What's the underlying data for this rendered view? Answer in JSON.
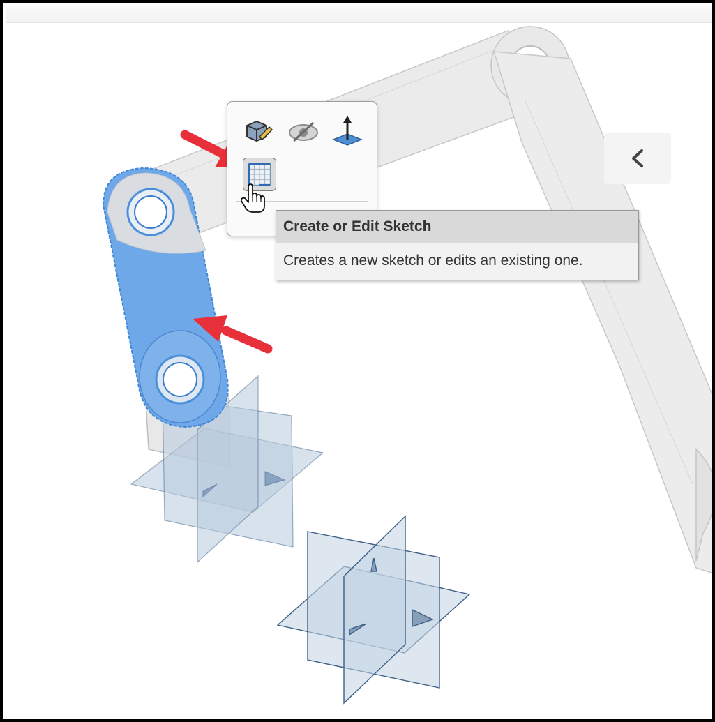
{
  "tooltip": {
    "title": "Create or Edit Sketch",
    "description": "Creates a new sketch or edits an existing one."
  },
  "toolbar": {
    "buttons": [
      {
        "icon": "edit-part-icon"
      },
      {
        "icon": "hide-icon"
      },
      {
        "icon": "normal-to-icon"
      },
      {
        "icon": "sketch-icon",
        "selected": true
      }
    ]
  },
  "colors": {
    "selected_face": "#6fa8e8",
    "selected_edge": "#3f86d8",
    "plane_fill": "#b8cadc",
    "plane_edge": "#4e6e92",
    "annotation_arrow": "#e8303a",
    "ghost_body": "#e6e6e6"
  }
}
